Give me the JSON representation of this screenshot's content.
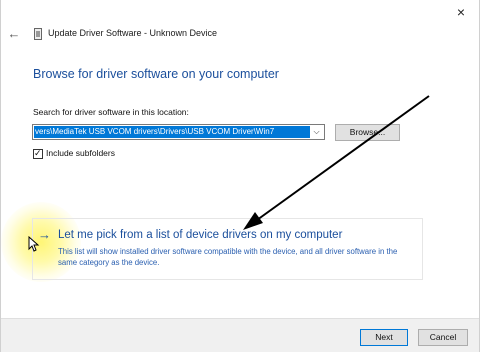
{
  "window": {
    "title": "Update Driver Software - Unknown Device",
    "close_glyph": "×",
    "back_glyph": "←"
  },
  "main": {
    "heading": "Browse for driver software on your computer",
    "search_label": "Search for driver software in this location:",
    "path_value": "vers\\MediaTek USB VCOM drivers\\Drivers\\USB VCOM Driver\\Win7",
    "browse_label": "Browse...",
    "include_subfolders": {
      "label": "Include subfolders",
      "checked": true
    }
  },
  "pick_option": {
    "arrow_glyph": "→",
    "title": "Let me pick from a list of device drivers on my computer",
    "description": "This list will show installed driver software compatible with the device, and all driver software in the same category as the device."
  },
  "footer": {
    "next_label": "Next",
    "cancel_label": "Cancel"
  },
  "colors": {
    "accent": "#0078d7",
    "link": "#1b4f9c",
    "highlight": "#fff56e"
  }
}
